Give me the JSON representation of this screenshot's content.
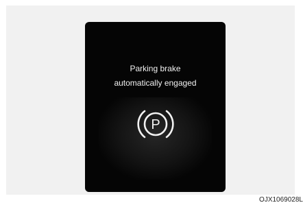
{
  "display": {
    "message_line1": "Parking brake",
    "message_line2": "automatically engaged",
    "icon": "parking-brake-icon",
    "icon_letter": "P",
    "icon_color": "#f2f2f2",
    "background_color": "#050505"
  },
  "figure": {
    "code": "OJX1069028L"
  }
}
